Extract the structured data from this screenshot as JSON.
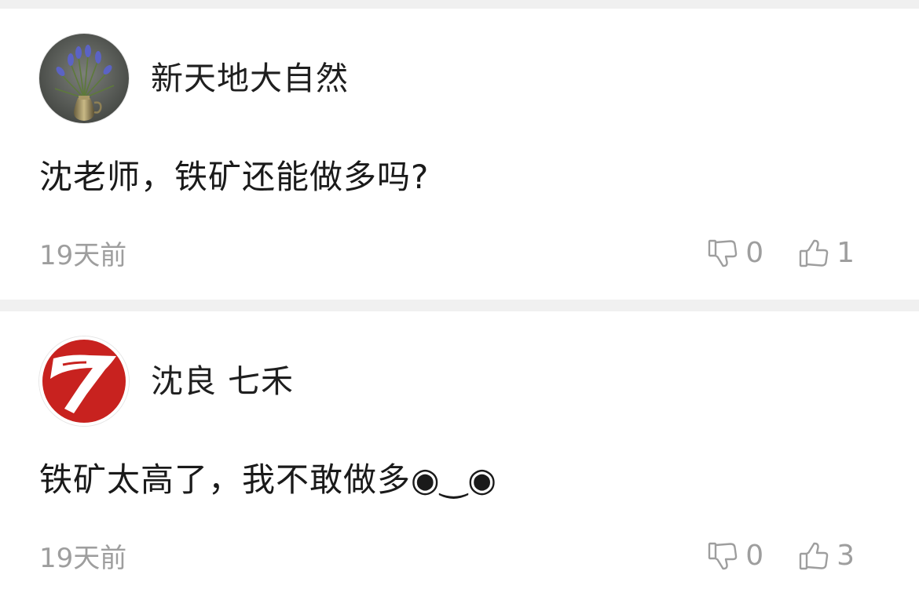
{
  "comments": [
    {
      "username": "新天地大自然",
      "avatar_icon": "flower-vase-avatar",
      "content": "沈老师，铁矿还能做多吗?",
      "emoticon": "",
      "time": "19天前",
      "dislike_count": "0",
      "like_count": "1"
    },
    {
      "username": "沈良 七禾",
      "avatar_icon": "seven-logo-avatar",
      "content": "铁矿太高了，我不敢做多",
      "emoticon": "◉‿◉",
      "time": "19天前",
      "dislike_count": "0",
      "like_count": "3"
    }
  ],
  "icons": {
    "dislike": "thumbs-down-icon",
    "like": "thumbs-up-icon"
  },
  "colors": {
    "background": "#f0f0f0",
    "card": "#ffffff",
    "meta_text": "#9e9e9e",
    "logo_red": "#c8221f"
  }
}
